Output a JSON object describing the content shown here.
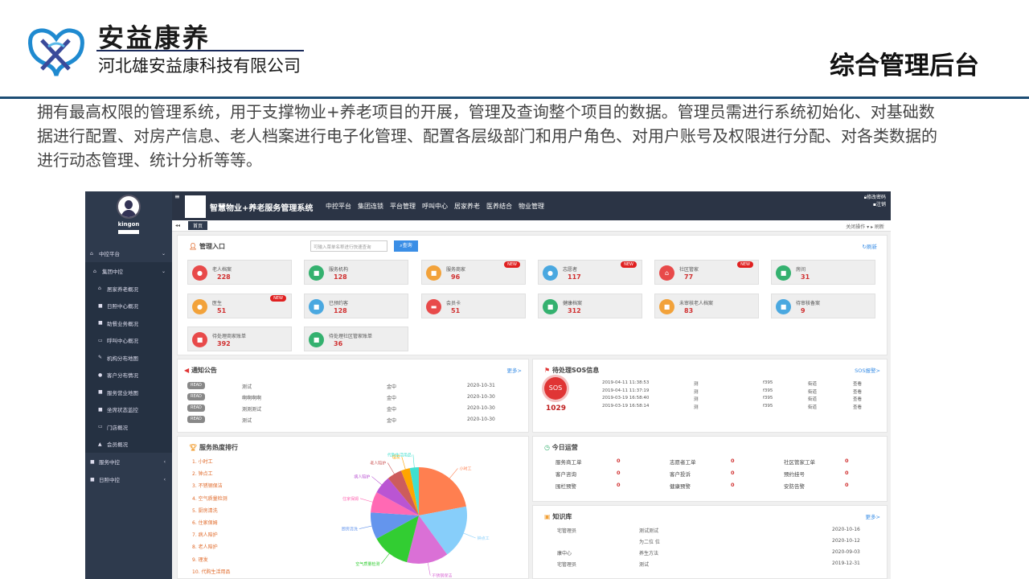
{
  "brand": {
    "name": "安益康养",
    "company": "河北雄安益康科技有限公司",
    "slide_title": "综合管理后台"
  },
  "description": "拥有最高权限的管理系统，用于支撑物业+养老项目的开展，管理及查询整个项目的数据。管理员需进行系统初始化、对基础数据进行配置、对房产信息、老人档案进行电子化管理、配置各层级部门和用户角色、对用户账号及权限进行分配、对各类数据的进行动态管理、统计分析等等。",
  "app": {
    "username": "kingon",
    "title": "智慧物业+养老服务管理系统",
    "nav": [
      "中控平台",
      "集团连锁",
      "平台管理",
      "呼叫中心",
      "居家养老",
      "医养结合",
      "物业管理"
    ],
    "top_right": [
      "修改密码",
      "注销"
    ],
    "tab_home": "首页",
    "tab_right": "关闭操作 ▾  ▸ 刷新"
  },
  "sidebar": {
    "top": "中控平台",
    "group": "集团中控",
    "items": [
      "居家养老概况",
      "日照中心概况",
      "助餐业务概况",
      "呼叫中心概况",
      "机构分布地图",
      "客户分布情况",
      "服务营业地图",
      "坐席状态监控",
      "门店概况",
      "会员概况"
    ],
    "after": [
      "服务中控",
      "日照中控"
    ]
  },
  "entry": {
    "title": "管理入口",
    "search_placeholder": "可输入菜单名称进行快速查询",
    "search_btn": "查询",
    "refresh": "刷新"
  },
  "cards": [
    {
      "label": "老人档案",
      "value": "228",
      "color": "#e84a4a",
      "icon": "●",
      "new": false
    },
    {
      "label": "服务机构",
      "value": "128",
      "color": "#34b16f",
      "icon": "■",
      "new": false
    },
    {
      "label": "服务商家",
      "value": "96",
      "color": "#f2a23a",
      "icon": "■",
      "new": true
    },
    {
      "label": "志愿者",
      "value": "117",
      "color": "#4aa8e0",
      "icon": "●",
      "new": true
    },
    {
      "label": "社区管家",
      "value": "77",
      "color": "#e84a4a",
      "icon": "⌂",
      "new": true
    },
    {
      "label": "房间",
      "value": "31",
      "color": "#34b16f",
      "icon": "■",
      "new": false
    },
    {
      "label": "医生",
      "value": "51",
      "color": "#f2a23a",
      "icon": "●",
      "new": true
    },
    {
      "label": "已预约客",
      "value": "128",
      "color": "#4aa8e0",
      "icon": "■",
      "new": false
    },
    {
      "label": "会员卡",
      "value": "51",
      "color": "#e84a4a",
      "icon": "▬",
      "new": false
    },
    {
      "label": "健康档案",
      "value": "312",
      "color": "#34b16f",
      "icon": "■",
      "new": false
    },
    {
      "label": "未审核老人档案",
      "value": "83",
      "color": "#f2a23a",
      "icon": "■",
      "new": false
    },
    {
      "label": "待审核备案",
      "value": "9",
      "color": "#4aa8e0",
      "icon": "■",
      "new": false
    },
    {
      "label": "待处理商家账单",
      "value": "392",
      "color": "#e84a4a",
      "icon": "■",
      "new": false
    },
    {
      "label": "待处理社区管家账单",
      "value": "36",
      "color": "#34b16f",
      "icon": "■",
      "new": false
    }
  ],
  "notices": {
    "title": "通知公告",
    "more": "更多>",
    "rows": [
      {
        "badge": "READ",
        "title": "测试",
        "org": "金中",
        "date": "2020-10-31"
      },
      {
        "badge": "READ",
        "title": "啊啊啊啊",
        "org": "金中",
        "date": "2020-10-30"
      },
      {
        "badge": "READ",
        "title": "测测测试",
        "org": "金中",
        "date": "2020-10-30"
      },
      {
        "badge": "READ",
        "title": "测试",
        "org": "金中",
        "date": "2020-10-30"
      }
    ]
  },
  "sos": {
    "title": "待处理SOS信息",
    "more": "SOS报警>",
    "label": "SOS",
    "count": "1029",
    "rows": [
      {
        "time": "2019-04-11 11:38:53",
        "a": "测",
        "b": "f395",
        "c": "街道",
        "d": "查看"
      },
      {
        "time": "2019-04-11 11:37:19",
        "a": "测",
        "b": "f395",
        "c": "街道",
        "d": "查看"
      },
      {
        "time": "2019-03-19 16:58:40",
        "a": "测",
        "b": "f395",
        "c": "街道",
        "d": "查看"
      },
      {
        "time": "2019-03-19 16:58:14",
        "a": "测",
        "b": "f395",
        "c": "街道",
        "d": "查看"
      }
    ]
  },
  "ranking": {
    "title": "服务热度排行",
    "items": [
      "1. 小时工",
      "2. 钟点工",
      "3. 不锈钢保洁",
      "4. 空气质量检测",
      "5. 厨房清洗",
      "6. 住家保姆",
      "7. 病人陪护",
      "8. 老人陪护",
      "9. 理发",
      "10. 代购生活用品"
    ]
  },
  "chart_data": {
    "type": "pie",
    "title": "",
    "categories": [
      "小时工",
      "钟点工",
      "不锈钢保洁",
      "空气质量检测",
      "厨房清洗",
      "住家保姆",
      "病人陪护",
      "老人陪护",
      "理发",
      "代购生活用品"
    ],
    "values": [
      22,
      18,
      14,
      13,
      9,
      7,
      6,
      5,
      3,
      3
    ],
    "colors": [
      "#ff7f50",
      "#87cefa",
      "#da70d6",
      "#32cd32",
      "#6495ed",
      "#ff69b4",
      "#ba55d3",
      "#cd5c5c",
      "#ffa500",
      "#40e0d0"
    ]
  },
  "today": {
    "title": "今日运营",
    "cells": [
      {
        "label": "服务商工单",
        "value": "0"
      },
      {
        "label": "志愿者工单",
        "value": "0"
      },
      {
        "label": "社区管家工单",
        "value": "0"
      },
      {
        "label": "客户咨询",
        "value": "0"
      },
      {
        "label": "客户投诉",
        "value": "0"
      },
      {
        "label": "预约挂号",
        "value": "0"
      },
      {
        "label": "围栏预警",
        "value": "0"
      },
      {
        "label": "健康预警",
        "value": "0"
      },
      {
        "label": "安防告警",
        "value": "0"
      }
    ]
  },
  "knowledge": {
    "title": "知识库",
    "more": "更多>",
    "rows": [
      {
        "a": "宅管理员",
        "b": "测试测试",
        "date": "2020-10-16"
      },
      {
        "a": "",
        "b": "为二位 位",
        "date": "2020-10-12"
      },
      {
        "a": "康中心",
        "b": "养生方法",
        "date": "2020-09-03"
      },
      {
        "a": "宅管理员",
        "b": "测试",
        "date": "2019-12-31"
      }
    ]
  }
}
